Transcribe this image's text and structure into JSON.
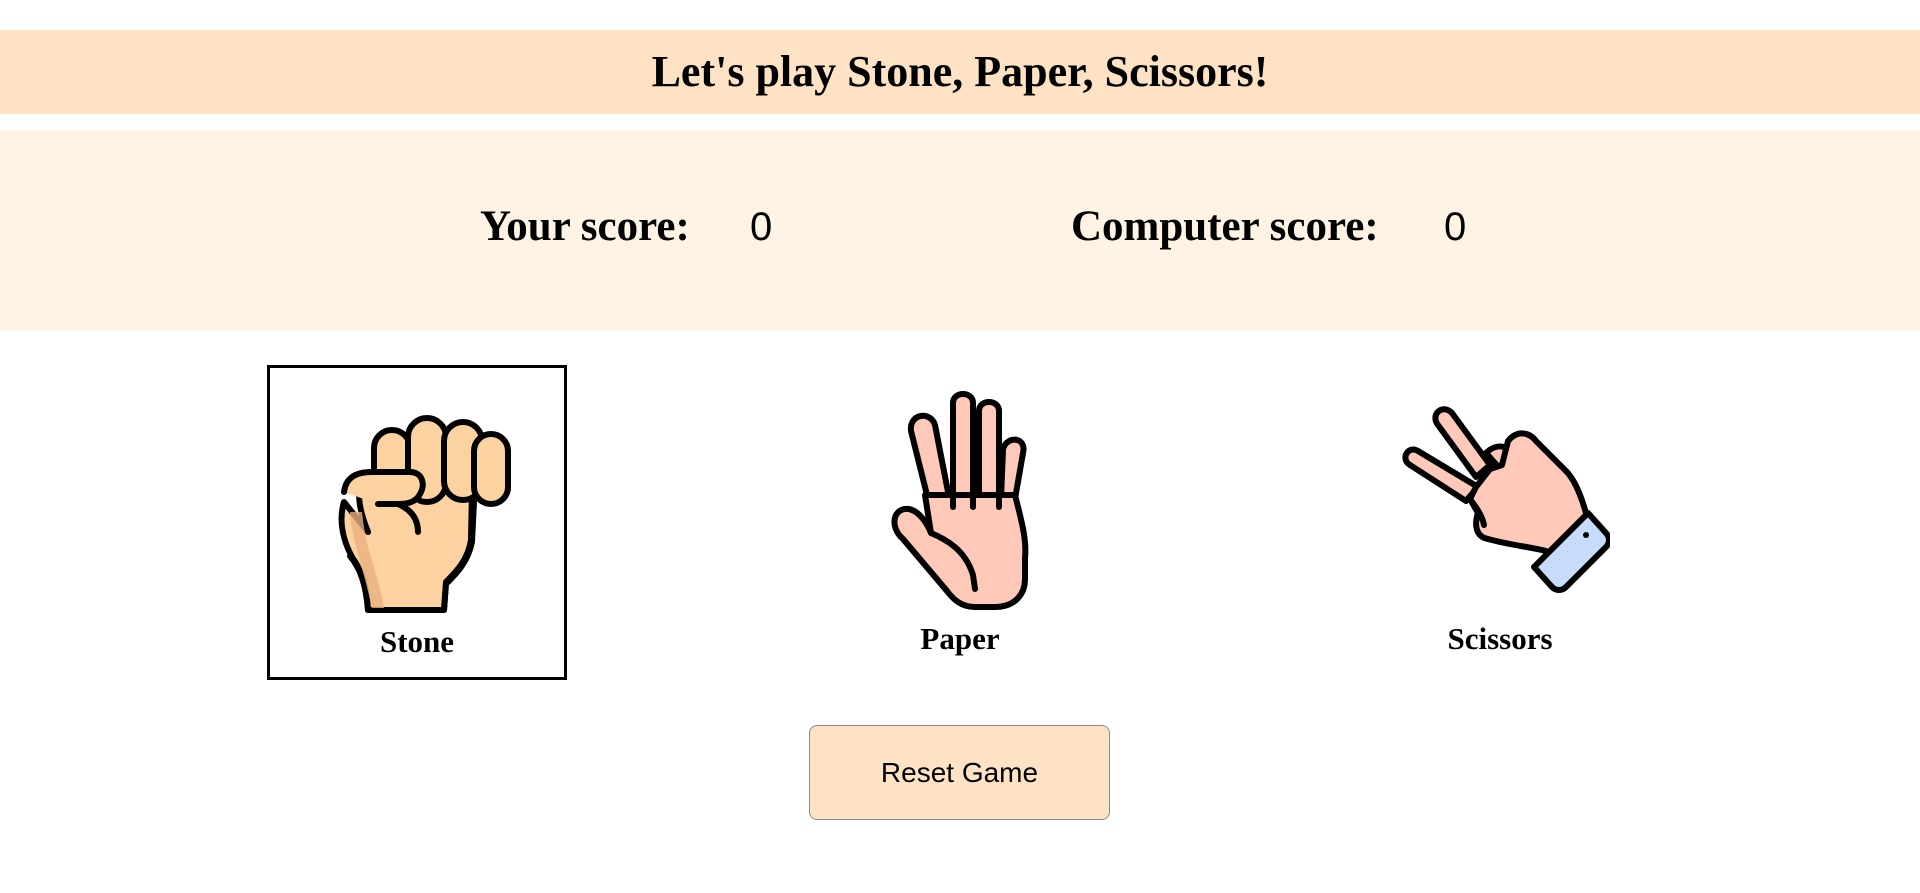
{
  "header": {
    "title": "Let's play Stone, Paper, Scissors!"
  },
  "scoreboard": {
    "player_label": "Your score:",
    "player_score": "0",
    "computer_label": "Computer score:",
    "computer_score": "0"
  },
  "choices": [
    {
      "label": "Stone",
      "icon": "fist-icon",
      "selected": true
    },
    {
      "label": "Paper",
      "icon": "open-hand-icon",
      "selected": false
    },
    {
      "label": "Scissors",
      "icon": "peace-hand-icon",
      "selected": false
    }
  ],
  "controls": {
    "reset_label": "Reset Game"
  },
  "colors": {
    "header_bg": "#fde3c3",
    "score_panel_bg": "#fef3e5",
    "button_bg": "#fde3c3",
    "skin_fist": "#fdd2a1",
    "skin_hand": "#ffc9b9",
    "cuff": "#c7dcfb"
  }
}
